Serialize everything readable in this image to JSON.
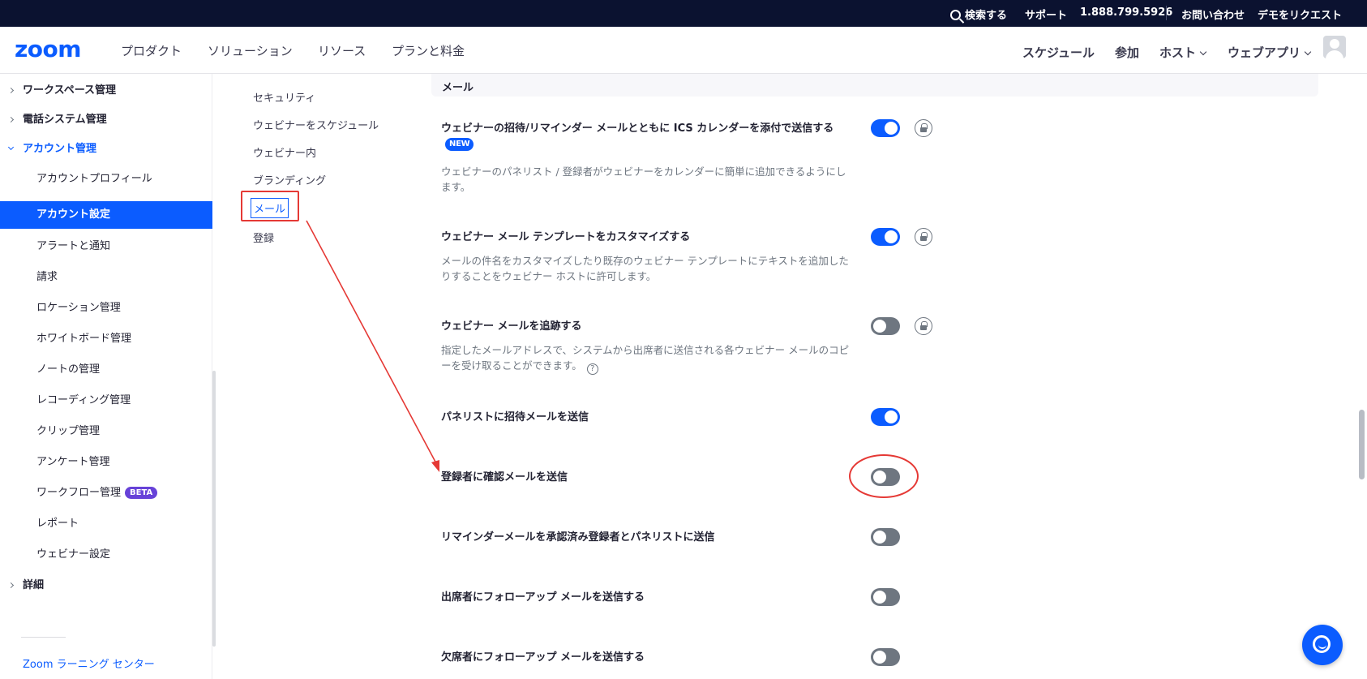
{
  "topbar": {
    "search": "検索する",
    "support": "サポート",
    "phone": "1.888.799.5926",
    "contact": "お問い合わせ",
    "demo": "デモをリクエスト"
  },
  "header": {
    "logo": "zoom",
    "nav": [
      "プロダクト",
      "ソリューション",
      "リソース",
      "プランと料金"
    ],
    "right": {
      "schedule": "スケジュール",
      "join": "参加",
      "host": "ホスト",
      "webapp": "ウェブアプリ"
    }
  },
  "sidebar": {
    "items": [
      "ワークスペース管理",
      "電話システム管理",
      "アカウント管理",
      "アカウントプロフィール",
      "アカウント設定",
      "アラートと通知",
      "請求",
      "ロケーション管理",
      "ホワイトボード管理",
      "ノートの管理",
      "レコーディング管理",
      "クリップ管理",
      "アンケート管理",
      "ワークフロー管理",
      "レポート",
      "ウェビナー設定",
      "詳細"
    ],
    "beta": "BETA",
    "learning": "Zoom ラーニング センター"
  },
  "subnav": [
    "セキュリティ",
    "ウェビナーをスケジュール",
    "ウェビナー内",
    "ブランディング",
    "メール",
    "登録"
  ],
  "main": {
    "section": "メール",
    "new_badge": "NEW",
    "settings": [
      {
        "title": "ウェビナーの招待/リマインダー メールとともに ICS カレンダーを添付で送信する",
        "desc": "ウェビナーのパネリスト / 登録者がウェビナーをカレンダーに簡単に追加できるようにします。",
        "on": true
      },
      {
        "title": "ウェビナー メール テンプレートをカスタマイズする",
        "desc": "メールの件名をカスタマイズしたり既存のウェビナー テンプレートにテキストを追加したりすることをウェビナー ホストに許可します。",
        "on": true
      },
      {
        "title": "ウェビナー メールを追跡する",
        "desc": "指定したメールアドレスで、システムから出席者に送信される各ウェビナー メールのコピーを受け取ることができます。",
        "on": false
      },
      {
        "title": "パネリストに招待メールを送信",
        "on": true
      },
      {
        "title": "登録者に確認メールを送信",
        "on": false
      },
      {
        "title": "リマインダーメールを承認済み登録者とパネリストに送信",
        "on": false
      },
      {
        "title": "出席者にフォローアップ メールを送信する",
        "on": false
      },
      {
        "title": "欠席者にフォローアップ メールを送信する",
        "on": false
      }
    ]
  },
  "colors": {
    "accent": "#0b5cff",
    "annotation": "#e53935",
    "topbar": "#0b1230"
  }
}
